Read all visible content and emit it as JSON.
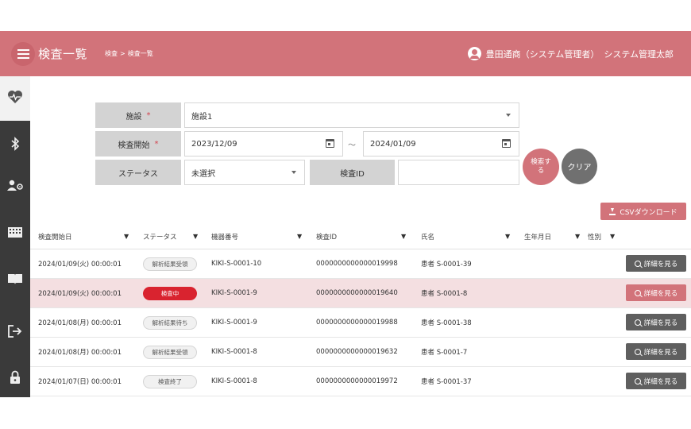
{
  "header": {
    "title": "検査一覧",
    "breadcrumb": [
      "検査",
      "検査一覧"
    ],
    "breadcrumb_sep": ">",
    "user_org": "豊田通商（システム管理者）",
    "user_name": "システム管理太郎"
  },
  "sidebar": {
    "items": [
      {
        "icon": "heart-pulse-icon",
        "glyph": "♥"
      },
      {
        "icon": "bluetooth-icon",
        "glyph": "ᛒ"
      },
      {
        "icon": "user-settings-icon",
        "glyph": "👥"
      },
      {
        "icon": "building-icon",
        "glyph": "▦"
      },
      {
        "icon": "book-icon",
        "glyph": "▯"
      },
      {
        "icon": "logout-icon",
        "glyph": "⇥"
      },
      {
        "icon": "lock-icon",
        "glyph": "🔒"
      }
    ]
  },
  "filters": {
    "facility": {
      "label": "施設",
      "required": "*",
      "value": "施設1"
    },
    "start": {
      "label": "検査開始",
      "required": "*",
      "from": "2023/12/09",
      "separator": "～",
      "to": "2024/01/09"
    },
    "status": {
      "label": "ステータス",
      "value": "未選択"
    },
    "exam_id": {
      "label": "検査ID",
      "value": ""
    },
    "search_label": "検索する",
    "clear_label": "クリア",
    "csv_label": "CSVダウンロード"
  },
  "table": {
    "columns": [
      "検査開始日",
      "ステータス",
      "機器番号",
      "検査ID",
      "氏名",
      "生年月日",
      "性別"
    ],
    "rows": [
      {
        "date": "2024/01/09(火) 00:00:01",
        "status": "解析結果受領",
        "device": "KIKI-S-0001-10",
        "exam_id": "0000000000000019998",
        "name": "患者 S-0001-39",
        "dob": "",
        "sex": "",
        "detail": "詳細を見る"
      },
      {
        "date": "2024/01/09(火) 00:00:01",
        "status": "検査中",
        "device": "KIKI-S-0001-9",
        "exam_id": "0000000000000019640",
        "name": "患者 S-0001-8",
        "dob": "",
        "sex": "",
        "detail": "詳細を見る"
      },
      {
        "date": "2024/01/08(月) 00:00:01",
        "status": "解析結果待ち",
        "device": "KIKI-S-0001-9",
        "exam_id": "0000000000000019988",
        "name": "患者 S-0001-38",
        "dob": "",
        "sex": "",
        "detail": "詳細を見る"
      },
      {
        "date": "2024/01/08(月) 00:00:01",
        "status": "解析結果受領",
        "device": "KIKI-S-0001-8",
        "exam_id": "0000000000000019632",
        "name": "患者 S-0001-7",
        "dob": "",
        "sex": "",
        "detail": "詳細を見る"
      },
      {
        "date": "2024/01/07(日) 00:00:01",
        "status": "検査終了",
        "device": "KIKI-S-0001-8",
        "exam_id": "0000000000000019972",
        "name": "患者 S-0001-37",
        "dob": "",
        "sex": "",
        "detail": "詳細を見る"
      }
    ]
  },
  "colors": {
    "accent": "#d2737a",
    "sidebar": "#3a3a3a",
    "highlight_row": "#f4dfe1",
    "status_active": "#d9232f",
    "detail_button": "#5f5f5f"
  }
}
